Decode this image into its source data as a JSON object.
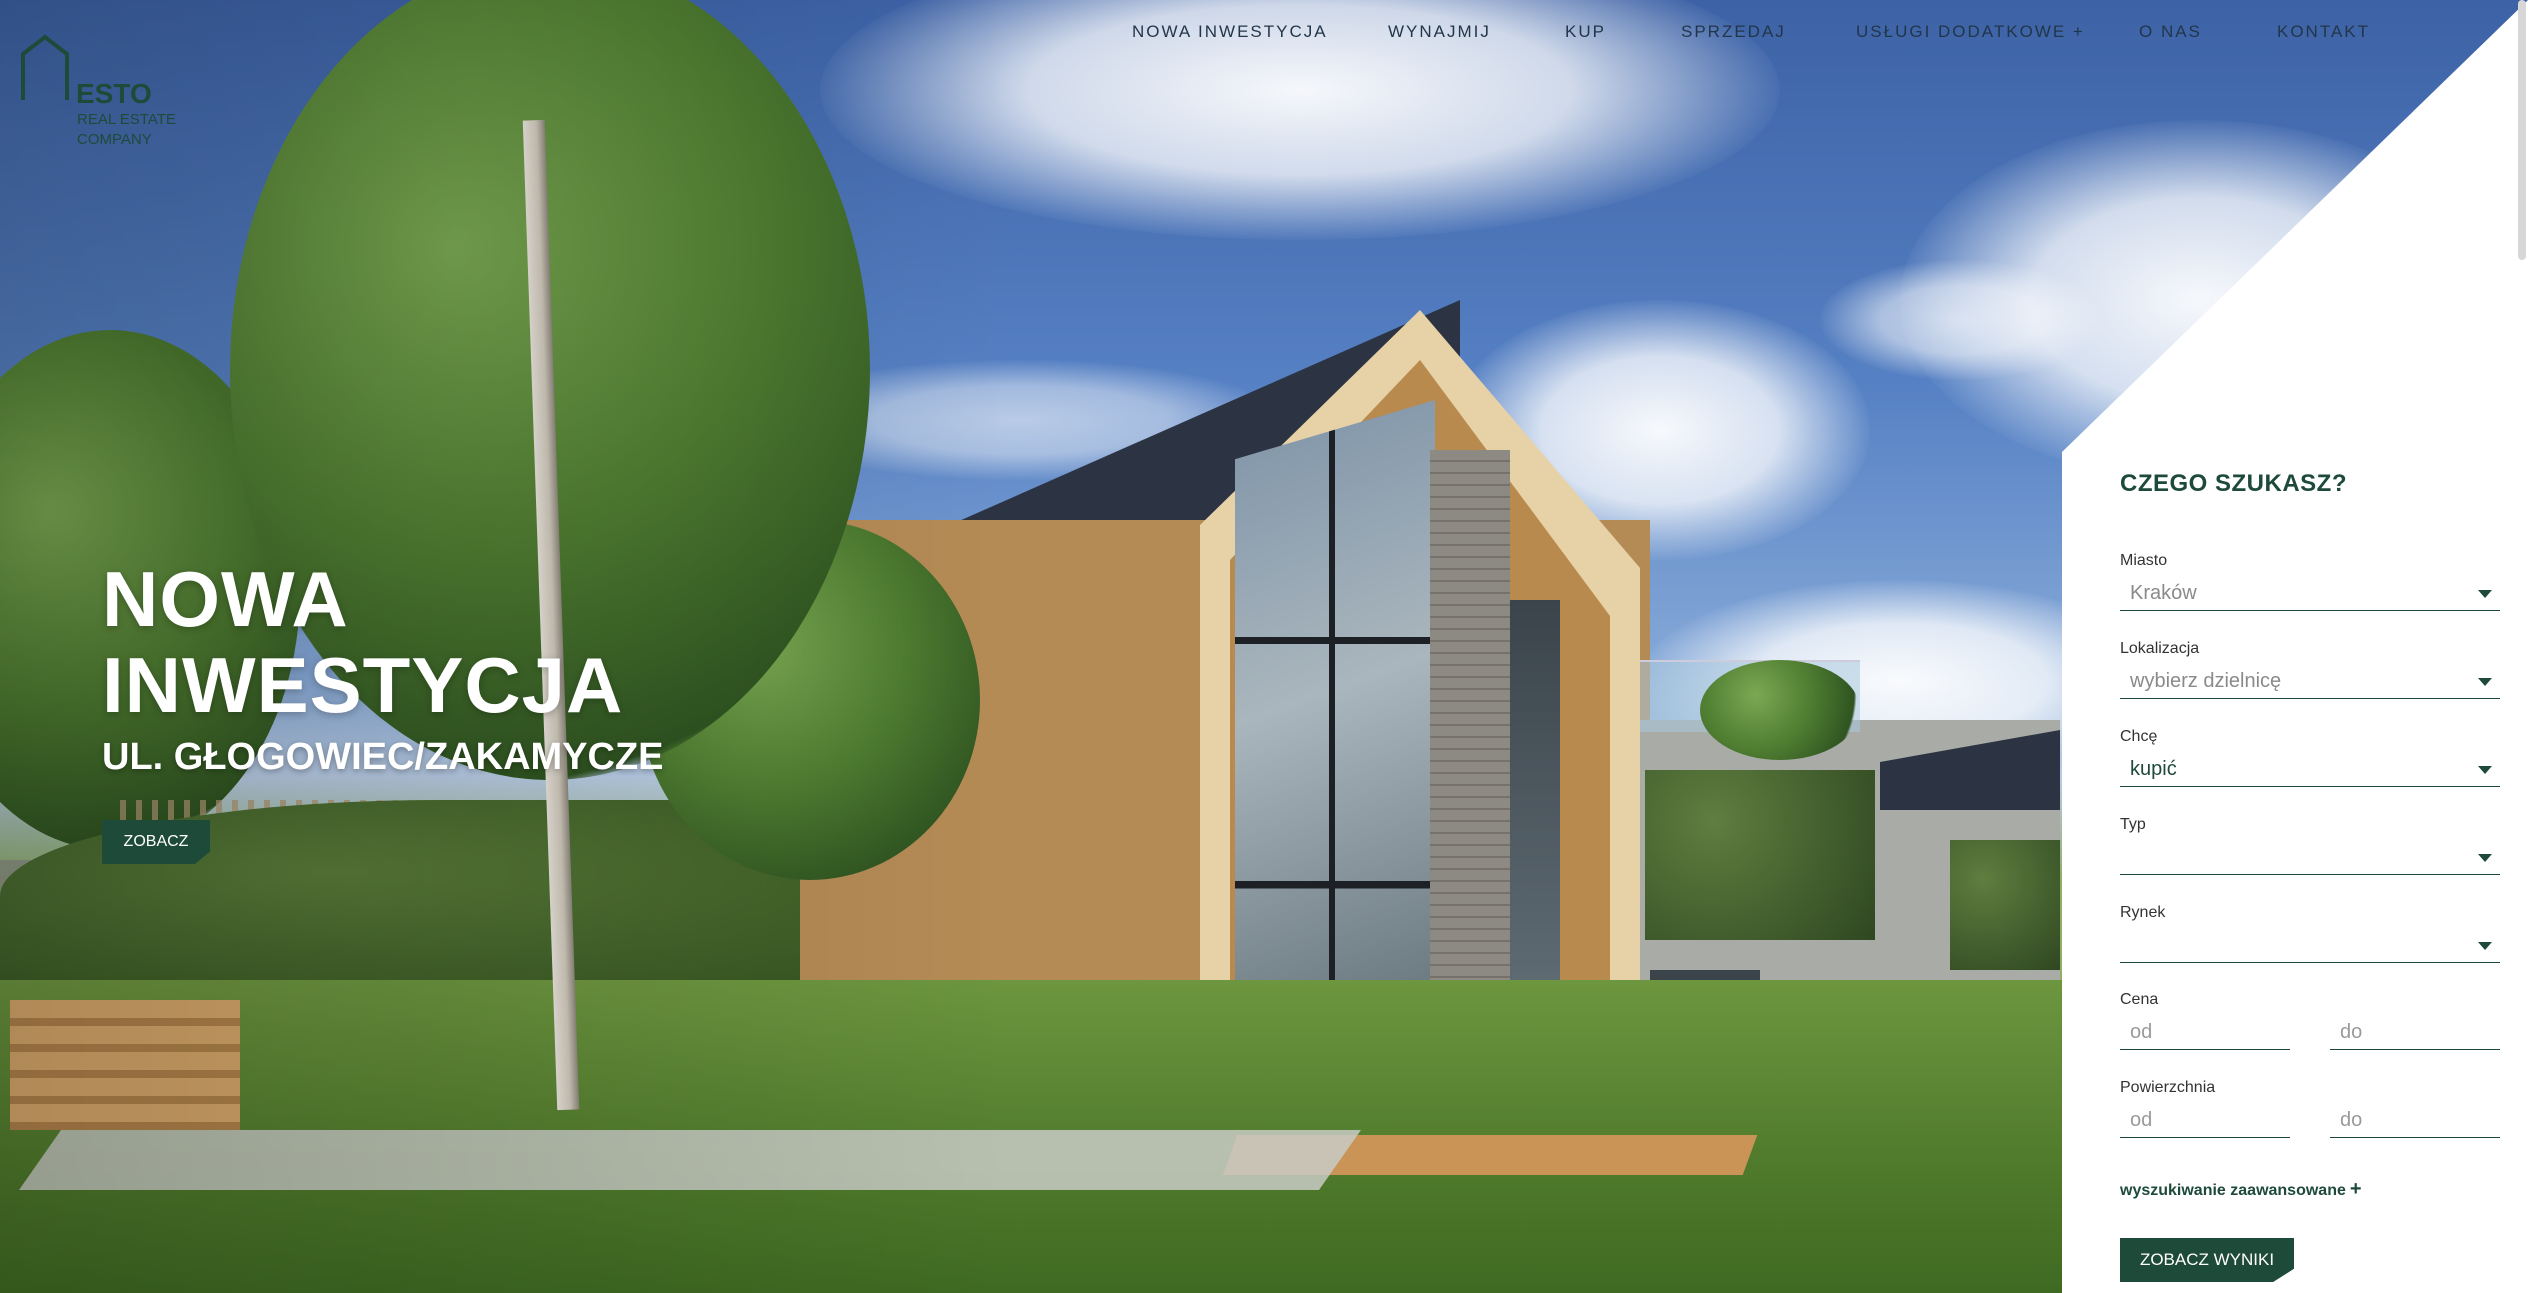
{
  "logo": {
    "name": "ESTO",
    "line1": "REAL ESTATE",
    "line2": "COMPANY"
  },
  "nav": {
    "items": [
      {
        "label": "NOWA INWESTYCJA"
      },
      {
        "label": "WYNAJMIJ"
      },
      {
        "label": "KUP"
      },
      {
        "label": "SPRZEDAJ"
      },
      {
        "label": "USŁUGI DODATKOWE +"
      },
      {
        "label": "O NAS"
      },
      {
        "label": "KONTAKT"
      }
    ]
  },
  "hero": {
    "title_line1": "NOWA",
    "title_line2": "INWESTYCJA",
    "subtitle": "UL. GŁOGOWIEC/ZAKAMYCZE",
    "button": "ZOBACZ"
  },
  "search": {
    "title": "CZEGO SZUKASZ?",
    "city": {
      "label": "Miasto",
      "value": "Kraków"
    },
    "location": {
      "label": "Lokalizacja",
      "value": "wybierz dzielnicę"
    },
    "want": {
      "label": "Chcę",
      "value": "kupić"
    },
    "type": {
      "label": "Typ",
      "value": ""
    },
    "market": {
      "label": "Rynek",
      "value": ""
    },
    "price": {
      "label": "Cena",
      "from": "od",
      "to": "do"
    },
    "area": {
      "label": "Powierzchnia",
      "from": "od",
      "to": "do"
    },
    "advanced": "wyszukiwanie zaawansowane",
    "advanced_icon": "+",
    "submit": "ZOBACZ WYNIKI"
  },
  "colors": {
    "brand": "#1e4a3a",
    "panel": "#ffffff"
  }
}
